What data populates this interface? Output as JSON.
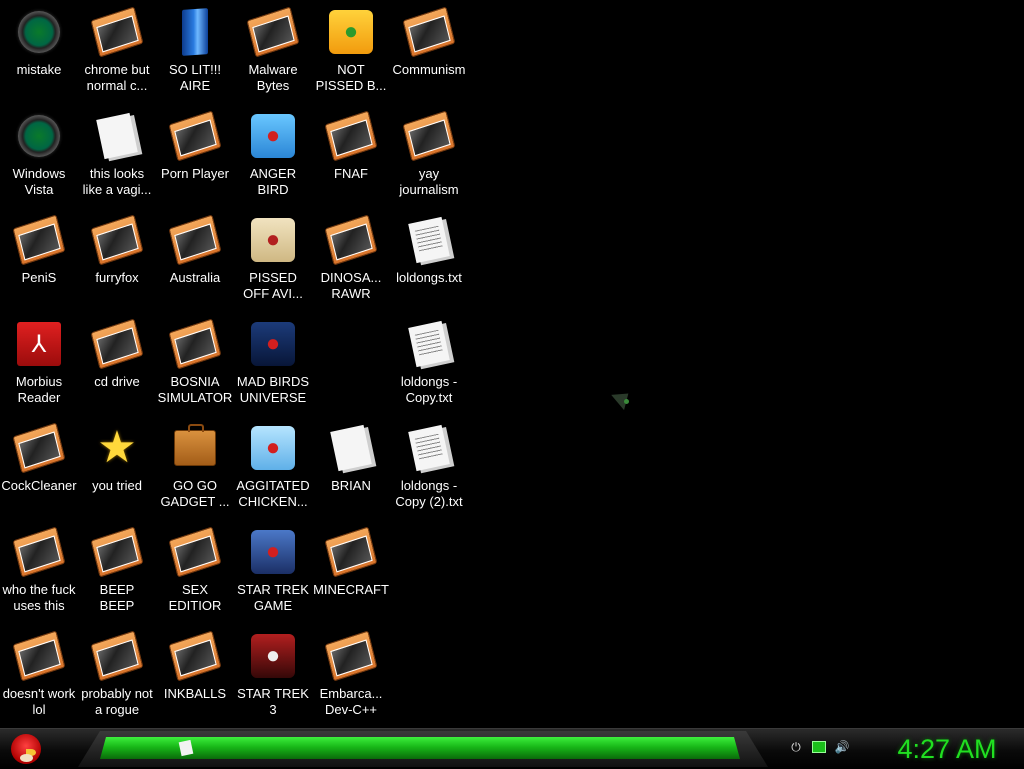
{
  "desktop": {
    "icons": [
      {
        "label": "mistake",
        "icon": "vista-orb-icon"
      },
      {
        "label": "chrome but\nnormal c...",
        "icon": "program-icon"
      },
      {
        "label": "SO LIT!!!\nAIRE",
        "icon": "blue-slab-icon"
      },
      {
        "label": "Malware\nBytes",
        "icon": "program-icon"
      },
      {
        "label": "NOT\nPISSED B...",
        "icon": "pig-icon"
      },
      {
        "label": "Communism",
        "icon": "program-icon"
      },
      {
        "label": "Windows\nVista",
        "icon": "recycle-orb-icon"
      },
      {
        "label": "this looks\nlike a vagi...",
        "icon": "document-icon"
      },
      {
        "label": "Porn Player",
        "icon": "program-icon"
      },
      {
        "label": "ANGER\nBIRD",
        "icon": "angry-bird-icon"
      },
      {
        "label": "FNAF",
        "icon": "program-icon"
      },
      {
        "label": "yay\njournalism",
        "icon": "program-icon"
      },
      {
        "label": "PeniS",
        "icon": "program-icon"
      },
      {
        "label": "furryfox",
        "icon": "program-icon"
      },
      {
        "label": "Australia",
        "icon": "program-icon"
      },
      {
        "label": "PISSED\nOFF AVI...",
        "icon": "seasons-icon"
      },
      {
        "label": "DINOSA...\nRAWR",
        "icon": "program-icon"
      },
      {
        "label": "loldongs.txt",
        "icon": "text-file-icon"
      },
      {
        "label": "Morbius\nReader",
        "icon": "pdf-icon"
      },
      {
        "label": "cd drive",
        "icon": "program-icon"
      },
      {
        "label": "BOSNIA\nSIMULATOR",
        "icon": "program-icon"
      },
      {
        "label": "MAD BIRDS\nUNIVERSE",
        "icon": "space-bird-icon"
      },
      {
        "label": "loldongs -\nCopy.txt",
        "icon": "text-file-icon"
      },
      {
        "label": "CockCleaner",
        "icon": "program-icon"
      },
      {
        "label": "you tried",
        "icon": "star-icon"
      },
      {
        "label": "GO GO\nGADGET ...",
        "icon": "briefcase-icon"
      },
      {
        "label": "AGGITATED\nCHICKEN...",
        "icon": "bird-ball-icon"
      },
      {
        "label": "BRIAN",
        "icon": "document-icon"
      },
      {
        "label": "loldongs -\nCopy (2).txt",
        "icon": "text-file-icon"
      },
      {
        "label": "who the fuck\nuses this",
        "icon": "program-icon"
      },
      {
        "label": "BEEP\nBEEP",
        "icon": "program-icon"
      },
      {
        "label": "SEX\nEDITIOR",
        "icon": "program-icon"
      },
      {
        "label": "STAR TREK\nGAME",
        "icon": "star-wars-bird-icon"
      },
      {
        "label": "MINECRAFT",
        "icon": "program-icon"
      },
      {
        "label": "doesn't work\nlol",
        "icon": "program-icon"
      },
      {
        "label": "probably not\na rogue",
        "icon": "program-icon"
      },
      {
        "label": "INKBALLS",
        "icon": "program-icon"
      },
      {
        "label": "STAR TREK\n3",
        "icon": "star-wars-3-icon"
      },
      {
        "label": "Embarca...\nDev-C++",
        "icon": "program-icon"
      }
    ]
  },
  "taskbar": {
    "clock": "4:27 AM",
    "tray": [
      "power-icon",
      "network-icon",
      "volume-icon"
    ],
    "accent": "#21e021"
  }
}
